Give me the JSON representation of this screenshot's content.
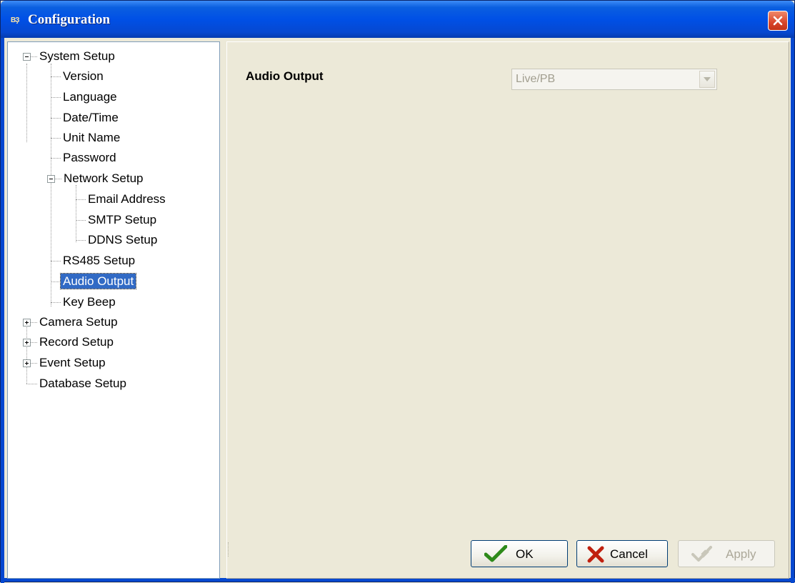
{
  "window": {
    "app_icon_text": "ВҘ",
    "title": "Configuration",
    "close_icon": "close-icon"
  },
  "tree": {
    "items": [
      {
        "label": "System Setup",
        "expander": "minus"
      },
      {
        "label": "Version"
      },
      {
        "label": "Language"
      },
      {
        "label": "Date/Time"
      },
      {
        "label": "Unit Name"
      },
      {
        "label": "Password"
      },
      {
        "label": "Network Setup",
        "expander": "minus"
      },
      {
        "label": "Email Address"
      },
      {
        "label": "SMTP Setup"
      },
      {
        "label": "DDNS Setup"
      },
      {
        "label": "RS485 Setup"
      },
      {
        "label": "Audio Output",
        "selected": true
      },
      {
        "label": "Key Beep"
      },
      {
        "label": "Camera Setup",
        "expander": "plus"
      },
      {
        "label": "Record Setup",
        "expander": "plus"
      },
      {
        "label": "Event Setup",
        "expander": "plus"
      },
      {
        "label": "Database Setup"
      }
    ]
  },
  "content": {
    "field_label": "Audio Output",
    "combo_value": "Live/PB",
    "combo_disabled": true
  },
  "buttons": {
    "ok": "OK",
    "cancel": "Cancel",
    "apply": "Apply",
    "apply_disabled": true
  },
  "colors": {
    "titlebar": "#0050e6",
    "selection": "#316ac5",
    "dialog_bg": "#ece9d8"
  }
}
